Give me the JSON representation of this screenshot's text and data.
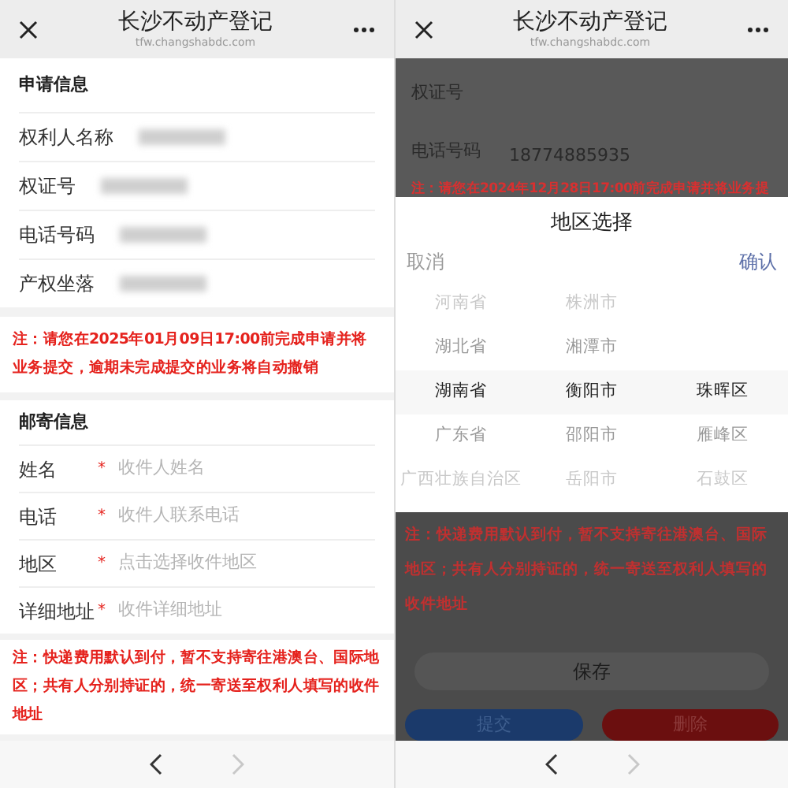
{
  "left_screen": {
    "header": {
      "title": "长沙不动产登记",
      "url": "tfw.changshabdc.com"
    },
    "application_section": {
      "title": "申请信息",
      "fields": [
        {
          "label": "权利人名称",
          "kind": "redacted"
        },
        {
          "label": "权证号",
          "kind": "redacted"
        },
        {
          "label": "电话号码",
          "kind": "redacted"
        },
        {
          "label": "产权坐落",
          "kind": "redacted"
        }
      ]
    },
    "deadline_notice": "注：请您在2025年01月09日17:00前完成申请并将业务提交，逾期未完成提交的业务将自动撤销",
    "mailing_section": {
      "title": "邮寄信息",
      "required_mark": "*",
      "fields": [
        {
          "label": "姓名",
          "required": true,
          "placeholder": "收件人姓名"
        },
        {
          "label": "电话",
          "required": true,
          "placeholder": "收件人联系电话"
        },
        {
          "label": "地区",
          "required": true,
          "placeholder": "点击选择收件地区"
        },
        {
          "label": "详细地址",
          "required": true,
          "placeholder": "收件详细地址"
        }
      ]
    },
    "shipping_notice": "注：快递费用默认到付，暂不支持寄往港澳台、国际地区；共有人分别持证的，统一寄送至权利人填写的收件地址",
    "nav": [
      {
        "kind": "back",
        "disabled": false
      },
      {
        "kind": "forward",
        "disabled": true
      }
    ]
  },
  "right_screen": {
    "header": {
      "title": "长沙不动产登记",
      "url": "tfw.changshabdc.com"
    },
    "fields": [
      {
        "label": "权证号"
      },
      {
        "label": "电话号码",
        "value": "18774885935"
      }
    ],
    "deadline_notice": "注：请您在2024年12月28日17:00前完成申请并将业务提",
    "region_picker": {
      "title": "地区选择",
      "cancel": "取消",
      "confirm": "确认",
      "rows": [
        {
          "cells": [
            "河南省",
            "株洲市"
          ],
          "selected": false
        },
        {
          "cells": [
            "湖北省",
            "湘潭市"
          ],
          "selected": false
        },
        {
          "cells": [
            "湖南省",
            "衡阳市",
            "珠晖区"
          ],
          "selected": true
        },
        {
          "cells": [
            "广东省",
            "邵阳市",
            "雁峰区"
          ],
          "selected": false
        },
        {
          "cells": [
            "广西壮族自治区",
            "岳阳市",
            "石鼓区"
          ],
          "selected": false
        }
      ]
    },
    "shipping_notice": "注：快递费用默认到付，暂不支持寄往港澳台、国际地区；共有人分别持证的，统一寄送至权利人填写的收件地址",
    "buttons": [
      {
        "kind": "save",
        "label": "保存"
      },
      {
        "kind": "submit",
        "label": "提交"
      },
      {
        "kind": "delete",
        "label": "删除"
      }
    ],
    "nav": [
      {
        "kind": "back",
        "disabled": false
      },
      {
        "kind": "forward",
        "disabled": true
      }
    ]
  }
}
